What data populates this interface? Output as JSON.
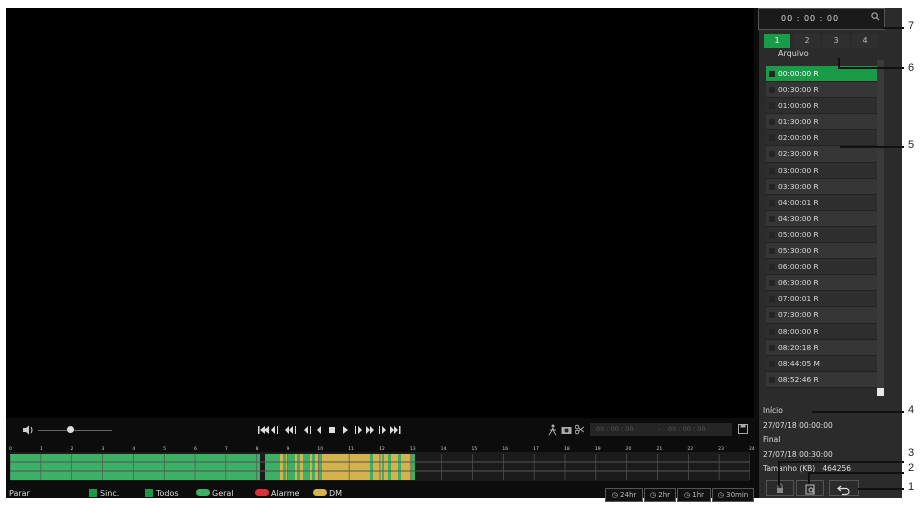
{
  "search": {
    "time": "00 : 00 : 00"
  },
  "tabs": [
    "1",
    "2",
    "3",
    "4"
  ],
  "list": {
    "header": "Arquivo",
    "rows": [
      "00:00:00  R",
      "00:30:00  R",
      "01:00:00  R",
      "01:30:00  R",
      "02:00:00  R",
      "02:30:00  R",
      "03:00:00  R",
      "03:30:00  R",
      "04:00:01  R",
      "04:30:00  R",
      "05:00:00  R",
      "05:30:00  R",
      "06:00:00  R",
      "06:30:00  R",
      "07:00:01  R",
      "07:30:00  R",
      "08:00:00  R",
      "08:20:18  R",
      "08:44:05  M",
      "08:52:46  R"
    ]
  },
  "info": {
    "start_label": "Início",
    "start_value": "27/07/18 00:00:00",
    "end_label": "Final",
    "end_value": "27/07/18 00:30:00",
    "size_label": "Tamanho (KB)",
    "size_value": "464256"
  },
  "clip_inputs": {
    "start": "00 : 00 : 00",
    "end": "00 : 00 : 00"
  },
  "timeline": {
    "hours": [
      "0",
      "1",
      "2",
      "3",
      "4",
      "5",
      "6",
      "7",
      "8",
      "9",
      "10",
      "11",
      "12",
      "13",
      "14",
      "15",
      "16",
      "17",
      "18",
      "19",
      "20",
      "21",
      "22",
      "23",
      "24"
    ]
  },
  "footer": {
    "status": "Parar",
    "sync": "Sinc.",
    "all": "Todos",
    "general": "Geral",
    "alarm": "Alarme",
    "motion": "DM",
    "zoom": [
      "24hr",
      "2hr",
      "1hr",
      "30min"
    ]
  },
  "callouts": [
    "7",
    "6",
    "5",
    "4",
    "3",
    "2",
    "1"
  ],
  "colors": {
    "accent": "#1a9b47",
    "general": "#3cb064",
    "alarm": "#d8333a",
    "motion": "#d4b24c"
  }
}
